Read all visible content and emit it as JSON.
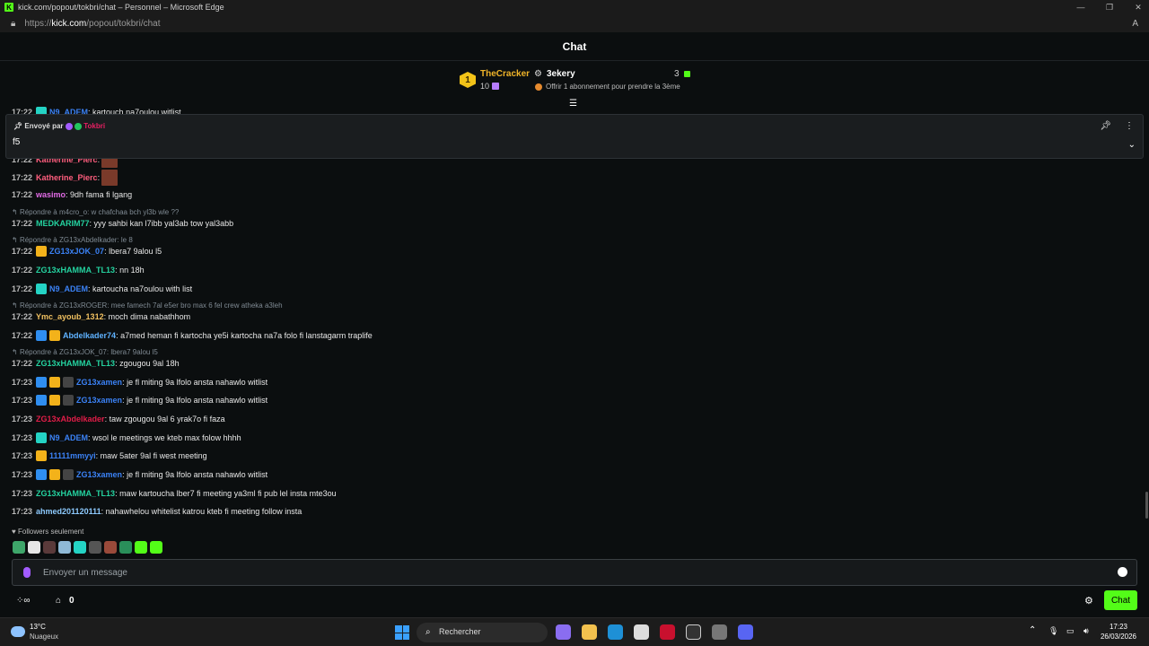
{
  "window": {
    "title": "kick.com/popout/tokbri/chat – Personnel – Microsoft Edge",
    "favicon": "K"
  },
  "address": {
    "prefix": "https://",
    "domain": "kick.com",
    "path": "/popout/tokbri/chat"
  },
  "chat": {
    "header": "Chat"
  },
  "leaderboard": {
    "first_name": "TheCracker",
    "first_count": "10",
    "first_rank": "1",
    "second_name": "3ekery",
    "second_count": "3",
    "offer_text": "Offrir 1 abonnement pour prendre la 3ème"
  },
  "pinned": {
    "label": "Envoyé par",
    "author": "Tokbri",
    "content": "f5"
  },
  "partial_top": {
    "time": "17:22",
    "user": "N9_ADEM",
    "text": ": kartouch na7oulou witlist"
  },
  "messages": [
    {
      "time": "17:22",
      "user": "Katherine_Pierc",
      "text": ":",
      "color": "#ff5e7e"
    },
    {
      "time": "17:22",
      "user": "wasimo",
      "text": ": 9dh fama fi lgang",
      "color": "#e26be6"
    },
    {
      "reply": "Répondre à m4cro_o: w chafchaa bch yl3b wle ??"
    },
    {
      "time": "17:22",
      "user": "MEDKARIM77",
      "text": ": yyy sahbi kan l7ibb yal3ab tow yal3abb",
      "color": "#24d3a0"
    },
    {
      "reply": "Répondre à ZG13xAbdelkader: le 8"
    },
    {
      "time": "17:22",
      "user": "ZG13xJOK_07",
      "text": ": lbera7 9alou l5",
      "color": "#3b82f6"
    },
    {
      "time": "17:22",
      "user": "ZG13xHAMMA_TL13",
      "text": ": nn 18h",
      "color": "#24d3a0"
    },
    {
      "time": "17:22",
      "user": "N9_ADEM",
      "text": ": kartoucha na7oulou with list",
      "color": "#3b82f6"
    },
    {
      "reply": "Répondre à ZG13xROGER: mee famech 7al e5er bro max 6 fel crew atheka a3leh"
    },
    {
      "time": "17:22",
      "user": "Ymc_ayoub_1312",
      "text": ": moch dima nabathhom",
      "color": "#f0c060"
    },
    {
      "time": "17:22",
      "user": "Abdelkader74",
      "text": ": a7med heman fi kartocha ye5i kartocha na7a folo fi lanstagarm traplife",
      "color": "#5fb2ff"
    },
    {
      "reply": "Répondre à ZG13xJOK_07: lbera7 9alou l5"
    },
    {
      "time": "17:22",
      "user": "ZG13xHAMMA_TL13",
      "text": ": zgougou 9al 18h",
      "color": "#24d3a0"
    },
    {
      "time": "17:23",
      "user": "ZG13xamen",
      "text": ": je fl miting 9a lfolo ansta nahawlo witlist",
      "color": "#3b82f6"
    },
    {
      "time": "17:23",
      "user": "ZG13xamen",
      "text": ": je fl miting 9a lfolo ansta nahawlo witlist",
      "color": "#3b82f6"
    },
    {
      "time": "17:23",
      "user": "ZG13xAbdelkader",
      "text": ": taw zgougou 9al 6 yrak7o fi faza",
      "color": "#e11d48"
    },
    {
      "time": "17:23",
      "user": "N9_ADEM",
      "text": ": wsol le meetings we kteb max folow hhhh",
      "color": "#3b82f6"
    },
    {
      "time": "17:23",
      "user": "11111mmyyi",
      "text": ": maw 5ater 9al fi west meeting",
      "color": "#3b82f6"
    },
    {
      "time": "17:23",
      "user": "ZG13xamen",
      "text": ": je fl miting 9a lfolo ansta nahawlo witlist",
      "color": "#3b82f6"
    },
    {
      "time": "17:23",
      "user": "ZG13xHAMMA_TL13",
      "text": ": maw kartoucha lber7 fi meeting ya3ml fi pub lel insta mte3ou",
      "color": "#24d3a0"
    },
    {
      "time": "17:23",
      "user": "ahmed201120111",
      "text": ": nahawhelou whitelist katrou kteb fi meeting follow insta",
      "color": "#8ecbff"
    }
  ],
  "followers_only": "Followers seulement",
  "input": {
    "placeholder": "Envoyer un message"
  },
  "bottom": {
    "kicks": "0",
    "chat_button": "Chat"
  },
  "taskbar": {
    "temp": "13°C",
    "condition": "Nuageux",
    "search": "Rechercher",
    "time": "17:23",
    "date": "26/03/2026"
  }
}
